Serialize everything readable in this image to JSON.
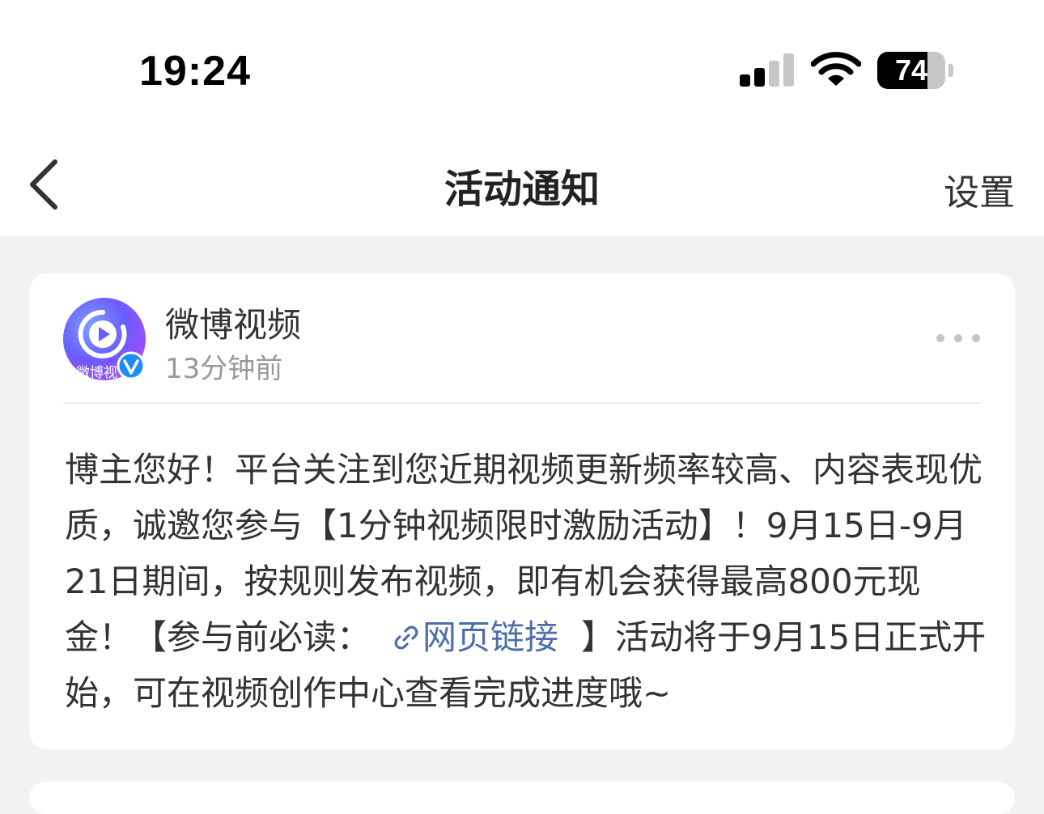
{
  "status_bar": {
    "time": "19:24",
    "battery_level": "74",
    "battery_fraction": 0.74,
    "icons": [
      "cellular-signal-icon",
      "wifi-icon",
      "battery-icon"
    ]
  },
  "nav": {
    "title": "活动通知",
    "settings_label": "设置",
    "back_icon": "chevron-left-icon"
  },
  "post": {
    "account_name": "微博视频",
    "avatar_caption": "微博视",
    "time": "13分钟前",
    "verified_icon": "verified-badge-icon",
    "more_icon": "more-dots-icon",
    "message": {
      "part1": "博主您好！平台关注到您近期视频更新频率较高、内容表现优质，诚邀您参与【1分钟视频限时激励活动】！9月15日-9月21日期间，按规则发布视频，即有机会获得最高800元现金！【参与前必读：",
      "link_label": "网页链接",
      "link_icon": "link-icon",
      "part2": "】活动将于9月15日正式开始，可在视频创作中心查看完成进度哦~"
    }
  },
  "colors": {
    "background": "#f2f2f2",
    "card": "#ffffff",
    "link": "#4d6ea8",
    "secondary_text": "#999999",
    "verified": "#1a8cff"
  }
}
